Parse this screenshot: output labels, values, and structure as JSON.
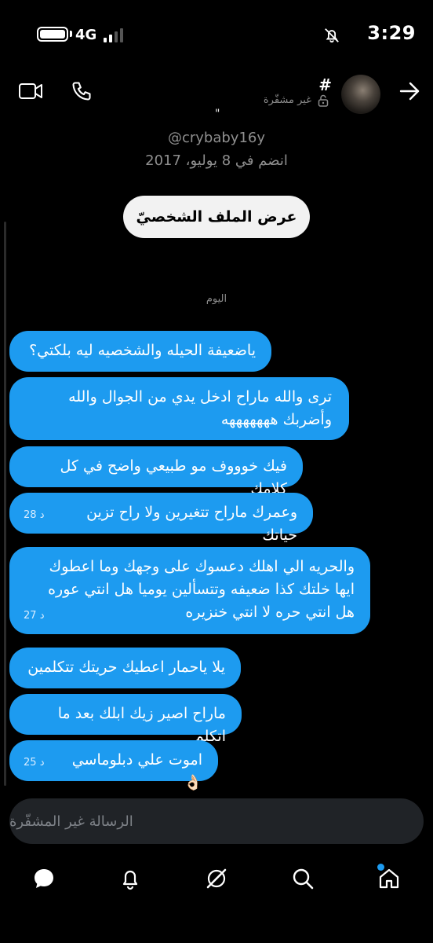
{
  "status_bar": {
    "time": "3:29",
    "network": "4G"
  },
  "header": {
    "title": "#",
    "unencrypted_label": "غير مشفّرة",
    "name_mark": "\"",
    "handle": "@crybaby16y",
    "joined": "انضم في 8 يوليو، 2017",
    "view_profile_label": "عرض الملف الشخصيّ"
  },
  "day_label": "اليوم",
  "messages": [
    {
      "text": "ياضعيفة الحيله والشخصيه ليه بلكتي؟",
      "time": ""
    },
    {
      "text": "ترى والله ماراح ادخل يدي من الجوال والله وأضربك هههههههه",
      "time": ""
    },
    {
      "text": "فيك خوووف مو طبيعي واضح في كل كلامك",
      "time": ""
    },
    {
      "text": "وعمرك ماراح تتغيرين ولا راح تزين حياتك",
      "time": "28 د"
    },
    {
      "text": "والحريه الي اهلك دعسوك على وجهك وما اعطوك ايها خلتك كذا ضعيفه وتتسألين يوميا هل انتي عوره هل انتي حره لا انتي خنزيره",
      "time": "27 د"
    },
    {
      "text": "يلا ياحمار اعطيك حريتك تتكلمين",
      "time": ""
    },
    {
      "text": "ماراح اصير زيك ابلك بعد ما اتكلم",
      "time": ""
    },
    {
      "text": "اموت علي دبلوماسي 👌🏻",
      "time": "25 د"
    }
  ],
  "compose": {
    "placeholder": "الرسالة غير المشفّرة"
  },
  "nav": [
    "messages-icon",
    "notifications-icon",
    "grok-icon",
    "search-icon",
    "home-icon"
  ],
  "colors": {
    "accent": "#1d9bf0",
    "background": "#000000",
    "compose_bg": "#202327",
    "muted": "#8f8f8f"
  }
}
